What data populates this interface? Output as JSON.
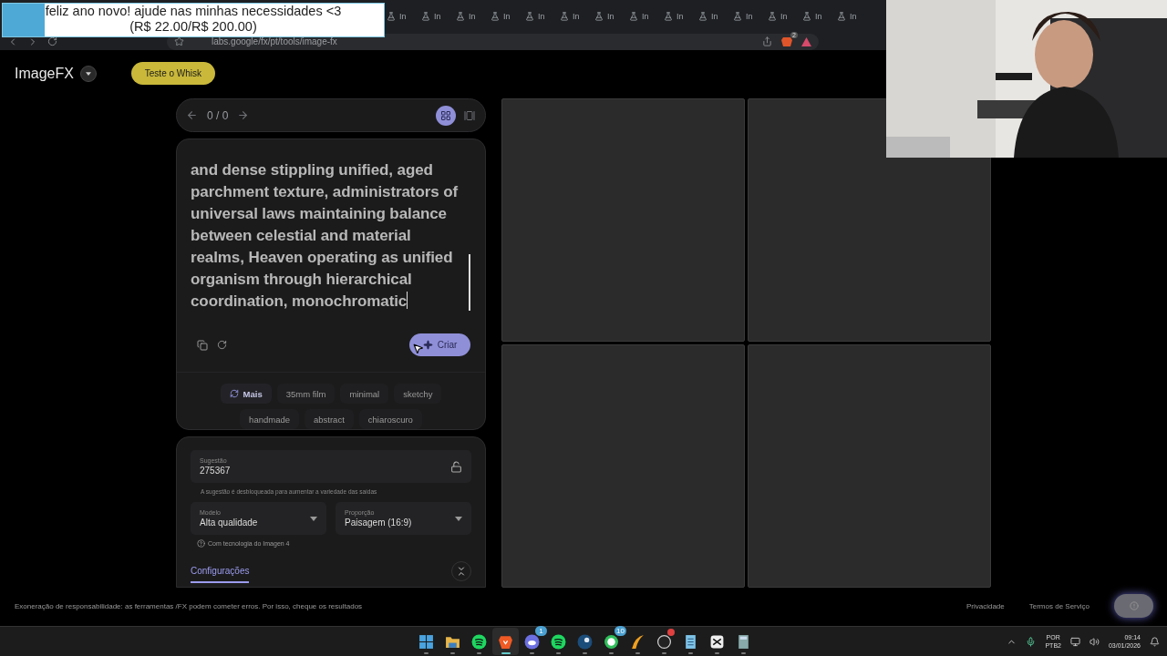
{
  "donation_banner": {
    "line_1": "feliz ano novo! ajude nas minhas necessidades <3",
    "line_2": "(R$ 22.00/R$ 200.00)",
    "level": 0.11
  },
  "browser": {
    "tabs": [
      {
        "label": "In"
      },
      {
        "label": "In"
      },
      {
        "label": "In"
      },
      {
        "label": "In"
      },
      {
        "label": "In"
      },
      {
        "label": "In"
      },
      {
        "label": "In"
      },
      {
        "label": "In"
      },
      {
        "label": "In"
      },
      {
        "label": "In"
      },
      {
        "label": "In"
      },
      {
        "label": "In"
      },
      {
        "label": "In"
      },
      {
        "label": "In"
      }
    ],
    "url": "labs.google/fx/pt/tools/image-fx",
    "extension_badge": "2"
  },
  "header": {
    "logo": "ImageFX",
    "whisk_button": "Teste o Whisk"
  },
  "navigator": {
    "counter": "0 / 0",
    "view_modes": [
      {
        "kind": "grid",
        "selected": true
      },
      {
        "kind": "single",
        "selected": false
      }
    ]
  },
  "prompt": {
    "text": "and dense stippling unified, aged parchment texture, administrators of universal laws maintaining balance between celestial and material realms, Heaven operating as unified organism through hierarchical coordination, monochromatic",
    "create_button": "Criar"
  },
  "chips": [
    {
      "label": "Mais",
      "kind": "refresh"
    },
    {
      "label": "35mm film",
      "kind": "style"
    },
    {
      "label": "minimal",
      "kind": "style"
    },
    {
      "label": "sketchy",
      "kind": "style"
    },
    {
      "label": "handmade",
      "kind": "style"
    },
    {
      "label": "abstract",
      "kind": "style"
    },
    {
      "label": "chiaroscuro",
      "kind": "style"
    }
  ],
  "settings": {
    "seed": {
      "label": "Sugestão",
      "value": "275367",
      "locked": false
    },
    "seed_hint": "A sugestão é desbloqueada para aumentar a variedade das saídas",
    "dropdowns": [
      {
        "label": "Modelo",
        "value": "Alta qualidade"
      },
      {
        "label": "Proporção",
        "value": "Paisagem (16:9)"
      }
    ],
    "powered_by": "Com tecnologia do Imagen 4",
    "tabs": [
      {
        "label": "Configurações",
        "selected": true
      }
    ]
  },
  "results": [
    {
      "kind": "empty"
    },
    {
      "kind": "empty"
    },
    {
      "kind": "empty"
    },
    {
      "kind": "empty"
    }
  ],
  "footer": {
    "disclaimer": "Exoneração de responsabilidade: as ferramentas /FX podem cometer erros. Por isso, cheque os resultados",
    "links": [
      "Privacidade",
      "Termos de Serviço"
    ]
  },
  "taskbar": {
    "apps": [
      {
        "kind": "start",
        "active": false
      },
      {
        "kind": "folder",
        "active": false
      },
      {
        "kind": "music",
        "active": false
      },
      {
        "kind": "browser",
        "active": true
      },
      {
        "kind": "chat",
        "active": false,
        "badge": "1"
      },
      {
        "kind": "music",
        "active": false
      },
      {
        "kind": "game",
        "active": false
      },
      {
        "kind": "phone",
        "active": false,
        "badge": "10"
      },
      {
        "kind": "swoosh",
        "active": false
      },
      {
        "kind": "record",
        "active": false,
        "alert": true
      },
      {
        "kind": "notes",
        "active": false
      },
      {
        "kind": "editor",
        "active": false
      },
      {
        "kind": "calculator",
        "active": false
      }
    ],
    "language": [
      "POR",
      "PTB2"
    ],
    "time": "09:14",
    "date": "03/01/2026"
  }
}
